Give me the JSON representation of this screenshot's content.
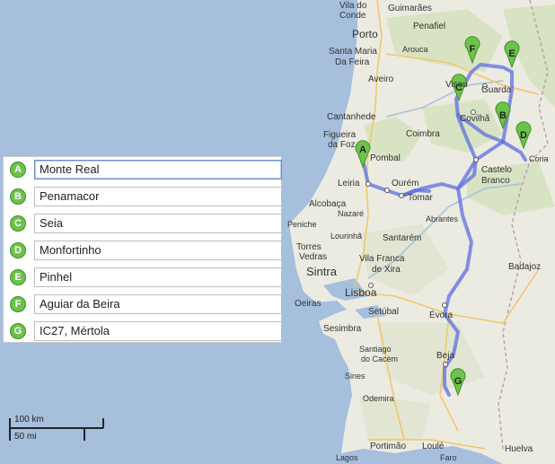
{
  "waypoints": [
    {
      "letter": "A",
      "value": "Monte Real"
    },
    {
      "letter": "B",
      "value": "Penamacor"
    },
    {
      "letter": "C",
      "value": "Seia"
    },
    {
      "letter": "D",
      "value": "Monfortinho"
    },
    {
      "letter": "E",
      "value": "Pinhel"
    },
    {
      "letter": "F",
      "value": "Aguiar da Beira"
    },
    {
      "letter": "G",
      "value": "IC27, Mértola"
    }
  ],
  "scale": {
    "km": "100 km",
    "mi": "50 mi"
  },
  "map_labels": {
    "vila_do_conde": "Vila do",
    "vila_do_conde_2": "Conde",
    "guimaraes": "Guimarães",
    "porto": "Porto",
    "penafiel": "Penafiel",
    "santa_maria": "Santa Maria",
    "da_feira": "Da Feira",
    "arouca": "Arouca",
    "aveiro": "Aveiro",
    "viseu": "Viseu",
    "guarda": "Guarda",
    "cantanhede": "Cantanhede",
    "coimbra": "Coimbra",
    "covilha": "Covilhã",
    "figueira": "Figueira",
    "da_foz": "da Foz",
    "pombal": "Pombal",
    "coria": "Coria",
    "castelo": "Castelo",
    "branco": "Branco",
    "leiria": "Leiria",
    "ourem": "Ourém",
    "alcobaca": "Alcobaça",
    "tomar": "Tomar",
    "nazare": "Nazaré",
    "abrantes": "Abrantes",
    "peniche": "Peniche",
    "lourinha": "Lourinhã",
    "santarem": "Santarém",
    "torres": "Torres",
    "vedras": "Vedras",
    "vila_franca": "Vila Franca",
    "de_xira": "de Xira",
    "sintra": "Sintra",
    "lisboa": "Lisboa",
    "oeiras": "Oeiras",
    "badajoz": "Badajoz",
    "evora": "Évora",
    "setubal": "Setúbal",
    "sesimbra": "Sesimbra",
    "santiago": "Santiago",
    "do_cacem": "do Cacém",
    "beja": "Beja",
    "sines": "Sines",
    "odemira": "Odemira",
    "portimao": "Portimão",
    "loule": "Loulé",
    "huelva": "Huelva",
    "lagos": "Lagos",
    "faro": "Faro"
  },
  "colors": {
    "land": "#ecebe2",
    "water": "#a5bfdd",
    "route": "#5c6fe0",
    "marker": "#6cc24a"
  }
}
